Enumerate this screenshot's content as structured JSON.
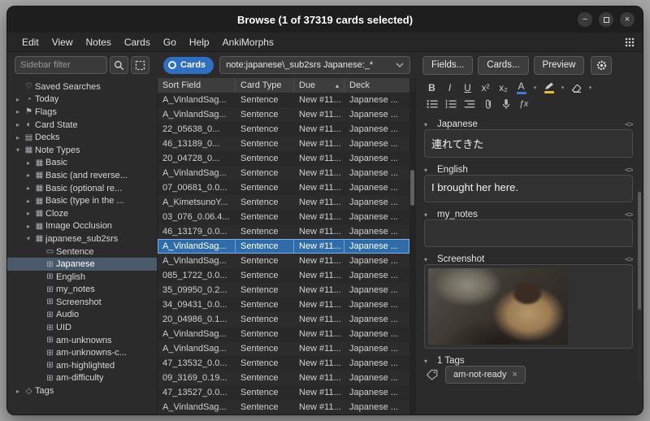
{
  "window": {
    "title": "Browse (1 of 37319 cards selected)",
    "minimize_glyph": "−",
    "close_glyph": "×"
  },
  "menubar": {
    "items": [
      {
        "name": "menu-edit",
        "label": "Edit"
      },
      {
        "name": "menu-view",
        "label": "View"
      },
      {
        "name": "menu-notes",
        "label": "Notes"
      },
      {
        "name": "menu-cards",
        "label": "Cards"
      },
      {
        "name": "menu-go",
        "label": "Go"
      },
      {
        "name": "menu-help",
        "label": "Help"
      },
      {
        "name": "menu-ankimorphs",
        "label": "AnkiMorphs"
      }
    ]
  },
  "sidebar": {
    "filter_placeholder": "Sidebar filter",
    "items": [
      {
        "name": "sidebar-item-saved-searches",
        "icon": "heart-icon",
        "glyph": "♡",
        "exp": "",
        "label": "Saved Searches",
        "depth": 0
      },
      {
        "name": "sidebar-item-today",
        "icon": "clock-icon",
        "glyph": "◔",
        "exp": "▸",
        "label": "Today",
        "depth": 0
      },
      {
        "name": "sidebar-item-flags",
        "icon": "flag-icon",
        "glyph": "⚑",
        "exp": "▸",
        "label": "Flags",
        "depth": 0
      },
      {
        "name": "sidebar-item-card-state",
        "icon": "card-state-icon",
        "glyph": "◐",
        "exp": "▸",
        "label": "Card State",
        "depth": 0
      },
      {
        "name": "sidebar-item-decks",
        "icon": "deck-icon",
        "glyph": "▤",
        "exp": "▸",
        "label": "Decks",
        "depth": 0
      },
      {
        "name": "sidebar-item-note-types",
        "icon": "note-types-icon",
        "glyph": "▦",
        "exp": "▾",
        "label": "Note Types",
        "depth": 0
      },
      {
        "name": "sidebar-item-basic",
        "icon": "note-type-icon",
        "glyph": "▦",
        "exp": "▸",
        "label": "Basic",
        "depth": 1
      },
      {
        "name": "sidebar-item-basic-and-reverse",
        "icon": "note-type-icon",
        "glyph": "▦",
        "exp": "▸",
        "label": "Basic (and reverse...",
        "depth": 1
      },
      {
        "name": "sidebar-item-basic-optional",
        "icon": "note-type-icon",
        "glyph": "▦",
        "exp": "▸",
        "label": "Basic (optional re...",
        "depth": 1
      },
      {
        "name": "sidebar-item-basic-type-in",
        "icon": "note-type-icon",
        "glyph": "▦",
        "exp": "▸",
        "label": "Basic (type in the ...",
        "depth": 1
      },
      {
        "name": "sidebar-item-cloze",
        "icon": "note-type-icon",
        "glyph": "▦",
        "exp": "▸",
        "label": "Cloze",
        "depth": 1
      },
      {
        "name": "sidebar-item-image-occlusion",
        "icon": "note-type-icon",
        "glyph": "▦",
        "exp": "▸",
        "label": "Image Occlusion",
        "depth": 1
      },
      {
        "name": "sidebar-item-japanese-sub2srs",
        "icon": "note-type-icon",
        "glyph": "▦",
        "exp": "▾",
        "label": "japanese_sub2srs",
        "depth": 1
      },
      {
        "name": "sidebar-item-sentence",
        "icon": "card-template-icon",
        "glyph": "▭",
        "exp": "",
        "label": "Sentence",
        "depth": 2
      },
      {
        "name": "sidebar-item-field-japanese",
        "icon": "field-icon",
        "glyph": "⊞",
        "exp": "",
        "label": "Japanese",
        "depth": 2,
        "selected": true
      },
      {
        "name": "sidebar-item-field-english",
        "icon": "field-icon",
        "glyph": "⊞",
        "exp": "",
        "label": "English",
        "depth": 2
      },
      {
        "name": "sidebar-item-field-my-notes",
        "icon": "field-icon",
        "glyph": "⊞",
        "exp": "",
        "label": "my_notes",
        "depth": 2
      },
      {
        "name": "sidebar-item-field-screenshot",
        "icon": "field-icon",
        "glyph": "⊞",
        "exp": "",
        "label": "Screenshot",
        "depth": 2
      },
      {
        "name": "sidebar-item-field-audio",
        "icon": "field-icon",
        "glyph": "⊞",
        "exp": "",
        "label": "Audio",
        "depth": 2
      },
      {
        "name": "sidebar-item-field-uid",
        "icon": "field-icon",
        "glyph": "⊞",
        "exp": "",
        "label": "UID",
        "depth": 2
      },
      {
        "name": "sidebar-item-field-am-unknowns",
        "icon": "field-icon",
        "glyph": "⊞",
        "exp": "",
        "label": "am-unknowns",
        "depth": 2
      },
      {
        "name": "sidebar-item-field-am-unknowns-c",
        "icon": "field-icon",
        "glyph": "⊞",
        "exp": "",
        "label": "am-unknowns-c...",
        "depth": 2
      },
      {
        "name": "sidebar-item-field-am-highlighted",
        "icon": "field-icon",
        "glyph": "⊞",
        "exp": "",
        "label": "am-highlighted",
        "depth": 2
      },
      {
        "name": "sidebar-item-field-am-difficulty",
        "icon": "field-icon",
        "glyph": "⊞",
        "exp": "",
        "label": "am-difficulty",
        "depth": 2
      },
      {
        "name": "sidebar-item-tags",
        "icon": "tag-icon",
        "glyph": "◇",
        "exp": "▸",
        "label": "Tags",
        "depth": 0
      }
    ]
  },
  "toolbar": {
    "cards_toggle_label": "Cards",
    "search_query": "note:japanese\\_sub2srs Japanese:_*",
    "fields_button": "Fields...",
    "cards_button": "Cards...",
    "preview_button": "Preview"
  },
  "table": {
    "columns": [
      {
        "name": "column-sort-field",
        "label": "Sort Field",
        "sort_glyph": ""
      },
      {
        "name": "column-card-type",
        "label": "Card Type",
        "sort_glyph": ""
      },
      {
        "name": "column-due",
        "label": "Due",
        "sort_glyph": "▴"
      },
      {
        "name": "column-deck",
        "label": "Deck",
        "sort_glyph": ""
      }
    ],
    "rows": [
      {
        "sort_field": "A_VinlandSag...",
        "card_type": "Sentence",
        "due": "New #11...",
        "deck": "Japanese ..."
      },
      {
        "sort_field": "A_VinlandSag...",
        "card_type": "Sentence",
        "due": "New #11...",
        "deck": "Japanese ..."
      },
      {
        "sort_field": "22_05638_0...",
        "card_type": "Sentence",
        "due": "New #11...",
        "deck": "Japanese ..."
      },
      {
        "sort_field": "46_13189_0...",
        "card_type": "Sentence",
        "due": "New #11...",
        "deck": "Japanese ..."
      },
      {
        "sort_field": "20_04728_0...",
        "card_type": "Sentence",
        "due": "New #11...",
        "deck": "Japanese ..."
      },
      {
        "sort_field": "A_VinlandSag...",
        "card_type": "Sentence",
        "due": "New #11...",
        "deck": "Japanese ..."
      },
      {
        "sort_field": "07_00681_0.0...",
        "card_type": "Sentence",
        "due": "New #11...",
        "deck": "Japanese ..."
      },
      {
        "sort_field": "A_KimetsunoY...",
        "card_type": "Sentence",
        "due": "New #11...",
        "deck": "Japanese ..."
      },
      {
        "sort_field": "03_076_0.06.4...",
        "card_type": "Sentence",
        "due": "New #11...",
        "deck": "Japanese ..."
      },
      {
        "sort_field": "46_13179_0.0...",
        "card_type": "Sentence",
        "due": "New #11...",
        "deck": "Japanese ..."
      },
      {
        "sort_field": "A_VinlandSag...",
        "card_type": "Sentence",
        "due": "New #11...",
        "deck": "Japanese ...",
        "selected": true
      },
      {
        "sort_field": "A_VinlandSag...",
        "card_type": "Sentence",
        "due": "New #11...",
        "deck": "Japanese ..."
      },
      {
        "sort_field": "085_1722_0.0...",
        "card_type": "Sentence",
        "due": "New #11...",
        "deck": "Japanese ..."
      },
      {
        "sort_field": "35_09950_0.2...",
        "card_type": "Sentence",
        "due": "New #11...",
        "deck": "Japanese ..."
      },
      {
        "sort_field": "34_09431_0.0...",
        "card_type": "Sentence",
        "due": "New #11...",
        "deck": "Japanese ..."
      },
      {
        "sort_field": "20_04986_0.1...",
        "card_type": "Sentence",
        "due": "New #11...",
        "deck": "Japanese ..."
      },
      {
        "sort_field": "A_VinlandSag...",
        "card_type": "Sentence",
        "due": "New #11...",
        "deck": "Japanese ..."
      },
      {
        "sort_field": "A_VinlandSag...",
        "card_type": "Sentence",
        "due": "New #11...",
        "deck": "Japanese ..."
      },
      {
        "sort_field": "47_13532_0.0...",
        "card_type": "Sentence",
        "due": "New #11...",
        "deck": "Japanese ..."
      },
      {
        "sort_field": "09_3169_0.19...",
        "card_type": "Sentence",
        "due": "New #11...",
        "deck": "Japanese ..."
      },
      {
        "sort_field": "47_13527_0.0...",
        "card_type": "Sentence",
        "due": "New #11...",
        "deck": "Japanese ..."
      },
      {
        "sort_field": "A_VinlandSag...",
        "card_type": "Sentence",
        "due": "New #11...",
        "deck": "Japanese ..."
      }
    ]
  },
  "editor": {
    "toolbar": {
      "bold": "B",
      "italic": "I",
      "underline": "U",
      "superscript": "x²",
      "subscript": "x₂",
      "text_color": "A",
      "dropdown": "▾",
      "math": "ƒx"
    },
    "collapse_glyph": "▾",
    "html_toggle_glyph": "<>",
    "fields": [
      {
        "label": "Japanese",
        "value": "連れてきた"
      },
      {
        "label": "English",
        "value": "I brought her here."
      },
      {
        "label": "my_notes",
        "value": ""
      },
      {
        "label": "Screenshot",
        "value": "",
        "content": "image"
      }
    ],
    "tags": {
      "header": "1 Tags",
      "items": [
        {
          "label": "am-not-ready",
          "remove_glyph": "×"
        }
      ]
    }
  },
  "colors": {
    "accent_blue": "#2d6fc2",
    "row_selection_blue": "#2e6cab",
    "sidebar_selection": "#4a5a6a",
    "highlight_bar_blue": "#3d7fd8",
    "highlight_bar_yellow": "#e3c02a"
  }
}
